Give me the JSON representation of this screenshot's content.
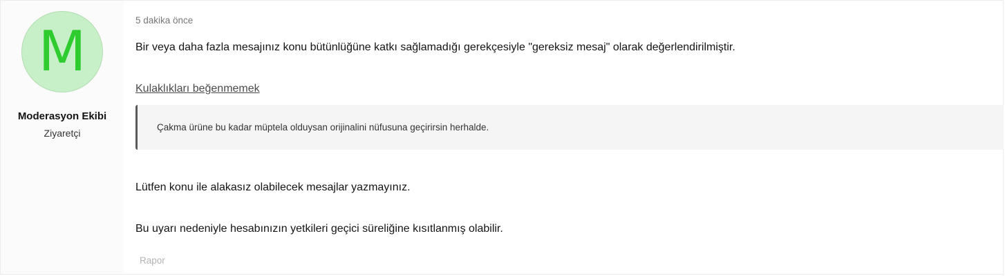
{
  "user": {
    "avatar_letter": "M",
    "name": "Moderasyon Ekibi",
    "title": "Ziyaretçi"
  },
  "post": {
    "timestamp": "5 dakika önce",
    "line1": "Bir veya daha fazla mesajınız konu bütünlüğüne katkı sağlamadığı gerekçesiyle \"gereksiz mesaj\" olarak değerlendirilmiştir.",
    "thread_link": "Kulaklıkları beğenmemek",
    "quote": "Çakma ürüne bu kadar müptela olduysan orijinalini nüfusuna geçirirsin herhalde.",
    "line2": "Lütfen konu ile alakasız olabilecek mesajlar yazmayınız.",
    "line3": "Bu uyarı nedeniyle hesabınızın yetkileri geçici süreliğine kısıtlanmış olabilir.",
    "report_label": "Rapor"
  },
  "colors": {
    "avatar_bg": "#c8f0c8",
    "avatar_letter": "#2fcc2f",
    "quote_border": "#5a5a5a",
    "quote_bg": "#f5f5f5"
  }
}
